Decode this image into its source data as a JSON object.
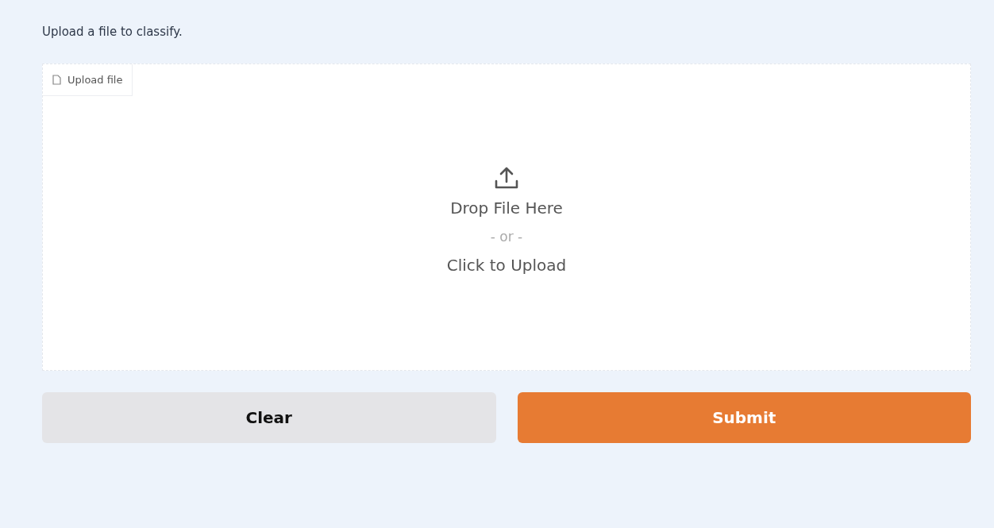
{
  "description": "Upload a file to classify.",
  "upload": {
    "label": "Upload file",
    "drop_text": "Drop File Here",
    "or_text": "- or -",
    "click_text": "Click to Upload"
  },
  "buttons": [
    {
      "label": "Clear",
      "kind": "secondary"
    },
    {
      "label": "Submit",
      "kind": "primary"
    }
  ]
}
